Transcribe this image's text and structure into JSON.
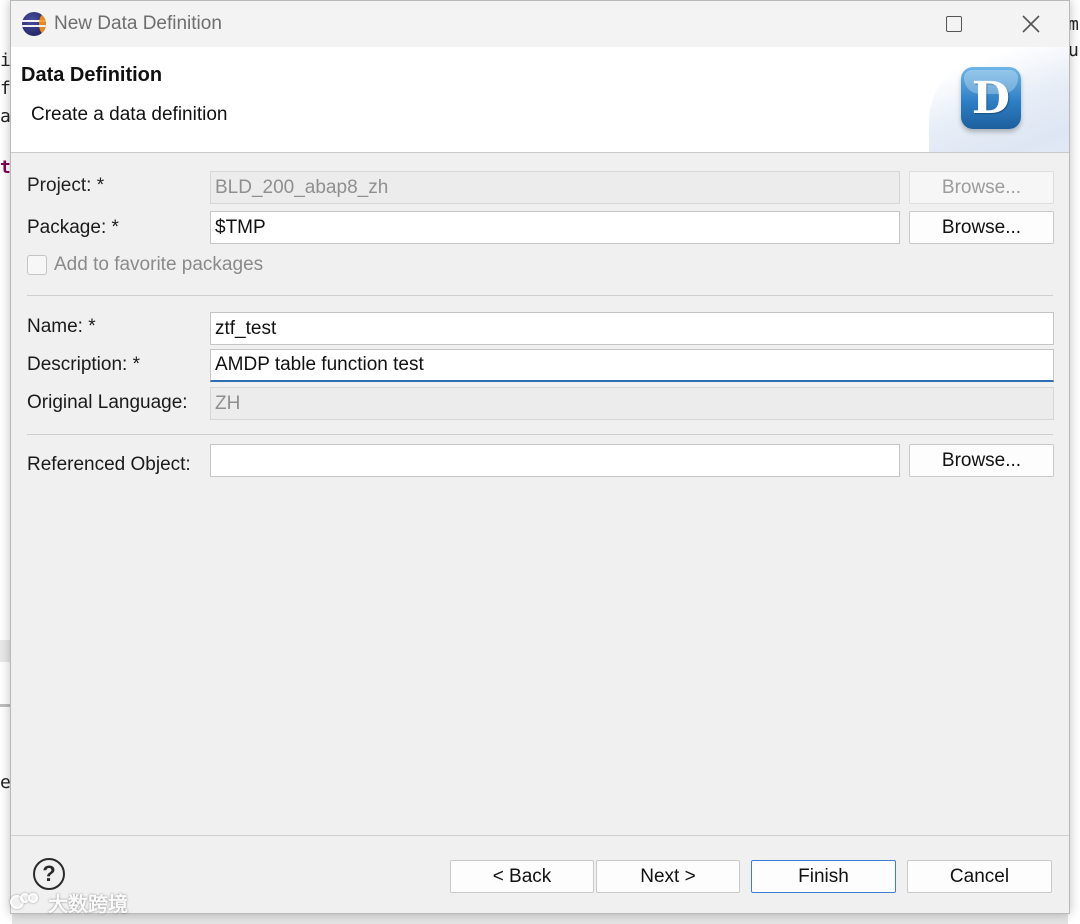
{
  "window": {
    "title": "New Data Definition"
  },
  "banner": {
    "title": "Data Definition",
    "description": "Create a data definition",
    "logo_letter": "D"
  },
  "background": {
    "left_chars": [
      "i",
      "f",
      "a",
      "t",
      "er"
    ],
    "right_chars": [
      "m",
      "u"
    ]
  },
  "form": {
    "project": {
      "label": "Project: *",
      "value": "BLD_200_abap8_zh",
      "browse": "Browse..."
    },
    "package": {
      "label": "Package: *",
      "value": "$TMP",
      "browse": "Browse..."
    },
    "favorite": {
      "label": "Add to favorite packages",
      "checked": false
    },
    "name": {
      "label": "Name: *",
      "value": "ztf_test"
    },
    "description": {
      "label": "Description: *",
      "value": "AMDP table function test"
    },
    "original_language": {
      "label": "Original Language:",
      "value": "ZH"
    },
    "referenced_object": {
      "label": "Referenced Object:",
      "value": "",
      "browse": "Browse..."
    }
  },
  "footer": {
    "help": "?",
    "back": "< Back",
    "next": "Next >",
    "finish": "Finish",
    "cancel": "Cancel"
  },
  "watermark": {
    "text": "大数跨境"
  },
  "colors": {
    "focus_accent": "#2f6fb3",
    "primary_border": "#3c7fd2",
    "logo_blue": "#2e7fc4"
  }
}
